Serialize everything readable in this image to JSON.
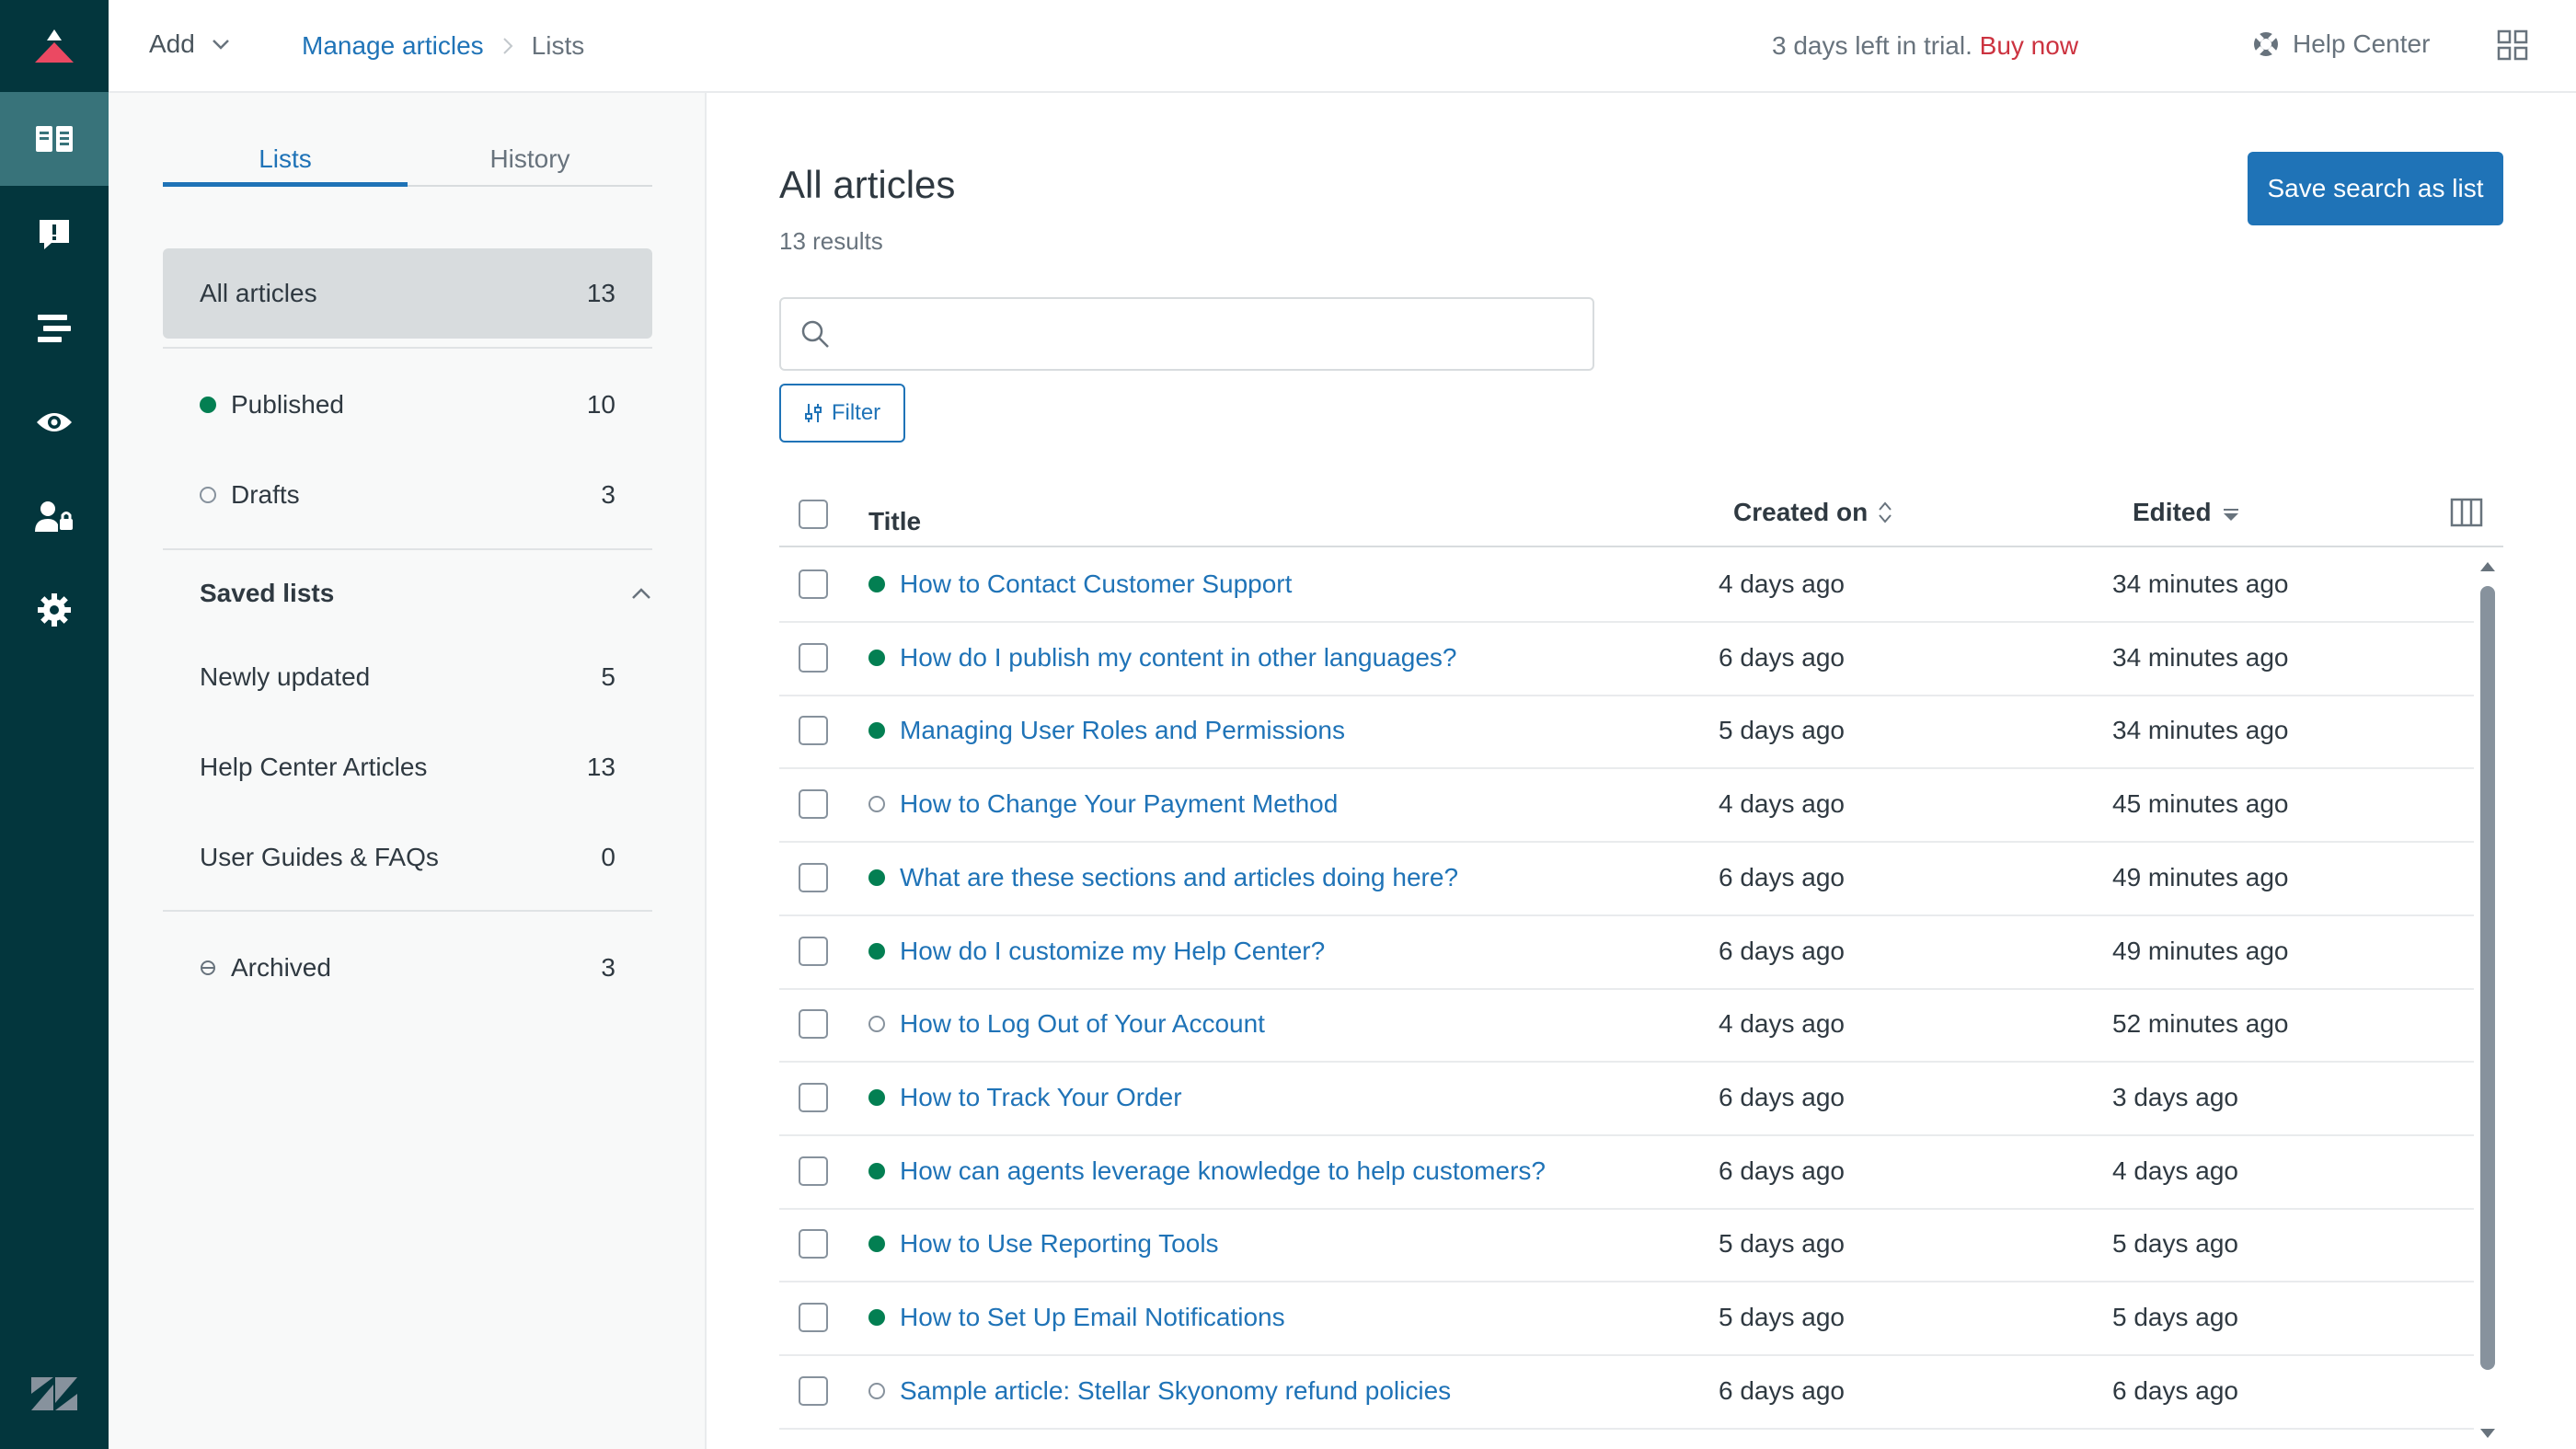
{
  "topbar": {
    "add_label": "Add",
    "breadcrumb_link": "Manage articles",
    "breadcrumb_current": "Lists",
    "trial_text": "3 days left in trial.",
    "buy_now": "Buy now",
    "help_center": "Help Center"
  },
  "sidebar": {
    "tabs": [
      "Lists",
      "History"
    ],
    "all_articles": {
      "label": "All articles",
      "count": "13"
    },
    "published": {
      "label": "Published",
      "count": "10"
    },
    "drafts": {
      "label": "Drafts",
      "count": "3"
    },
    "saved_lists_heading": "Saved lists",
    "saved_lists": [
      {
        "label": "Newly updated",
        "count": "5"
      },
      {
        "label": "Help Center Articles",
        "count": "13"
      },
      {
        "label": "User Guides & FAQs",
        "count": "0"
      }
    ],
    "archived": {
      "label": "Archived",
      "count": "3"
    }
  },
  "main": {
    "title": "All articles",
    "results": "13 results",
    "save_button": "Save search as list",
    "search_placeholder": "",
    "filter_label": "Filter",
    "columns": {
      "title": "Title",
      "created": "Created on",
      "edited": "Edited"
    },
    "rows": [
      {
        "title": "How to Contact Customer Support",
        "status": "published",
        "created": "4 days ago",
        "edited": "34 minutes ago"
      },
      {
        "title": "How do I publish my content in other languages?",
        "status": "published",
        "created": "6 days ago",
        "edited": "34 minutes ago"
      },
      {
        "title": "Managing User Roles and Permissions",
        "status": "published",
        "created": "5 days ago",
        "edited": "34 minutes ago"
      },
      {
        "title": "How to Change Your Payment Method",
        "status": "draft",
        "created": "4 days ago",
        "edited": "45 minutes ago"
      },
      {
        "title": "What are these sections and articles doing here?",
        "status": "published",
        "created": "6 days ago",
        "edited": "49 minutes ago"
      },
      {
        "title": "How do I customize my Help Center?",
        "status": "published",
        "created": "6 days ago",
        "edited": "49 minutes ago"
      },
      {
        "title": "How to Log Out of Your Account",
        "status": "draft",
        "created": "4 days ago",
        "edited": "52 minutes ago"
      },
      {
        "title": "How to Track Your Order",
        "status": "published",
        "created": "6 days ago",
        "edited": "3 days ago"
      },
      {
        "title": "How can agents leverage knowledge to help customers?",
        "status": "published",
        "created": "6 days ago",
        "edited": "4 days ago"
      },
      {
        "title": "How to Use Reporting Tools",
        "status": "published",
        "created": "5 days ago",
        "edited": "5 days ago"
      },
      {
        "title": "How to Set Up Email Notifications",
        "status": "published",
        "created": "5 days ago",
        "edited": "5 days ago"
      },
      {
        "title": "Sample article: Stellar Skyonomy refund policies",
        "status": "draft",
        "created": "6 days ago",
        "edited": "6 days ago"
      }
    ]
  },
  "colors": {
    "rail": "#03363d",
    "rail_active": "#38737a",
    "link": "#1f73b7",
    "published": "#037f52",
    "buy_now": "#cc3340"
  },
  "icons": {
    "rail": [
      "knowledge-icon",
      "feedback-icon",
      "arrange-icon",
      "view-icon",
      "user-permissions-icon",
      "settings-icon"
    ]
  }
}
